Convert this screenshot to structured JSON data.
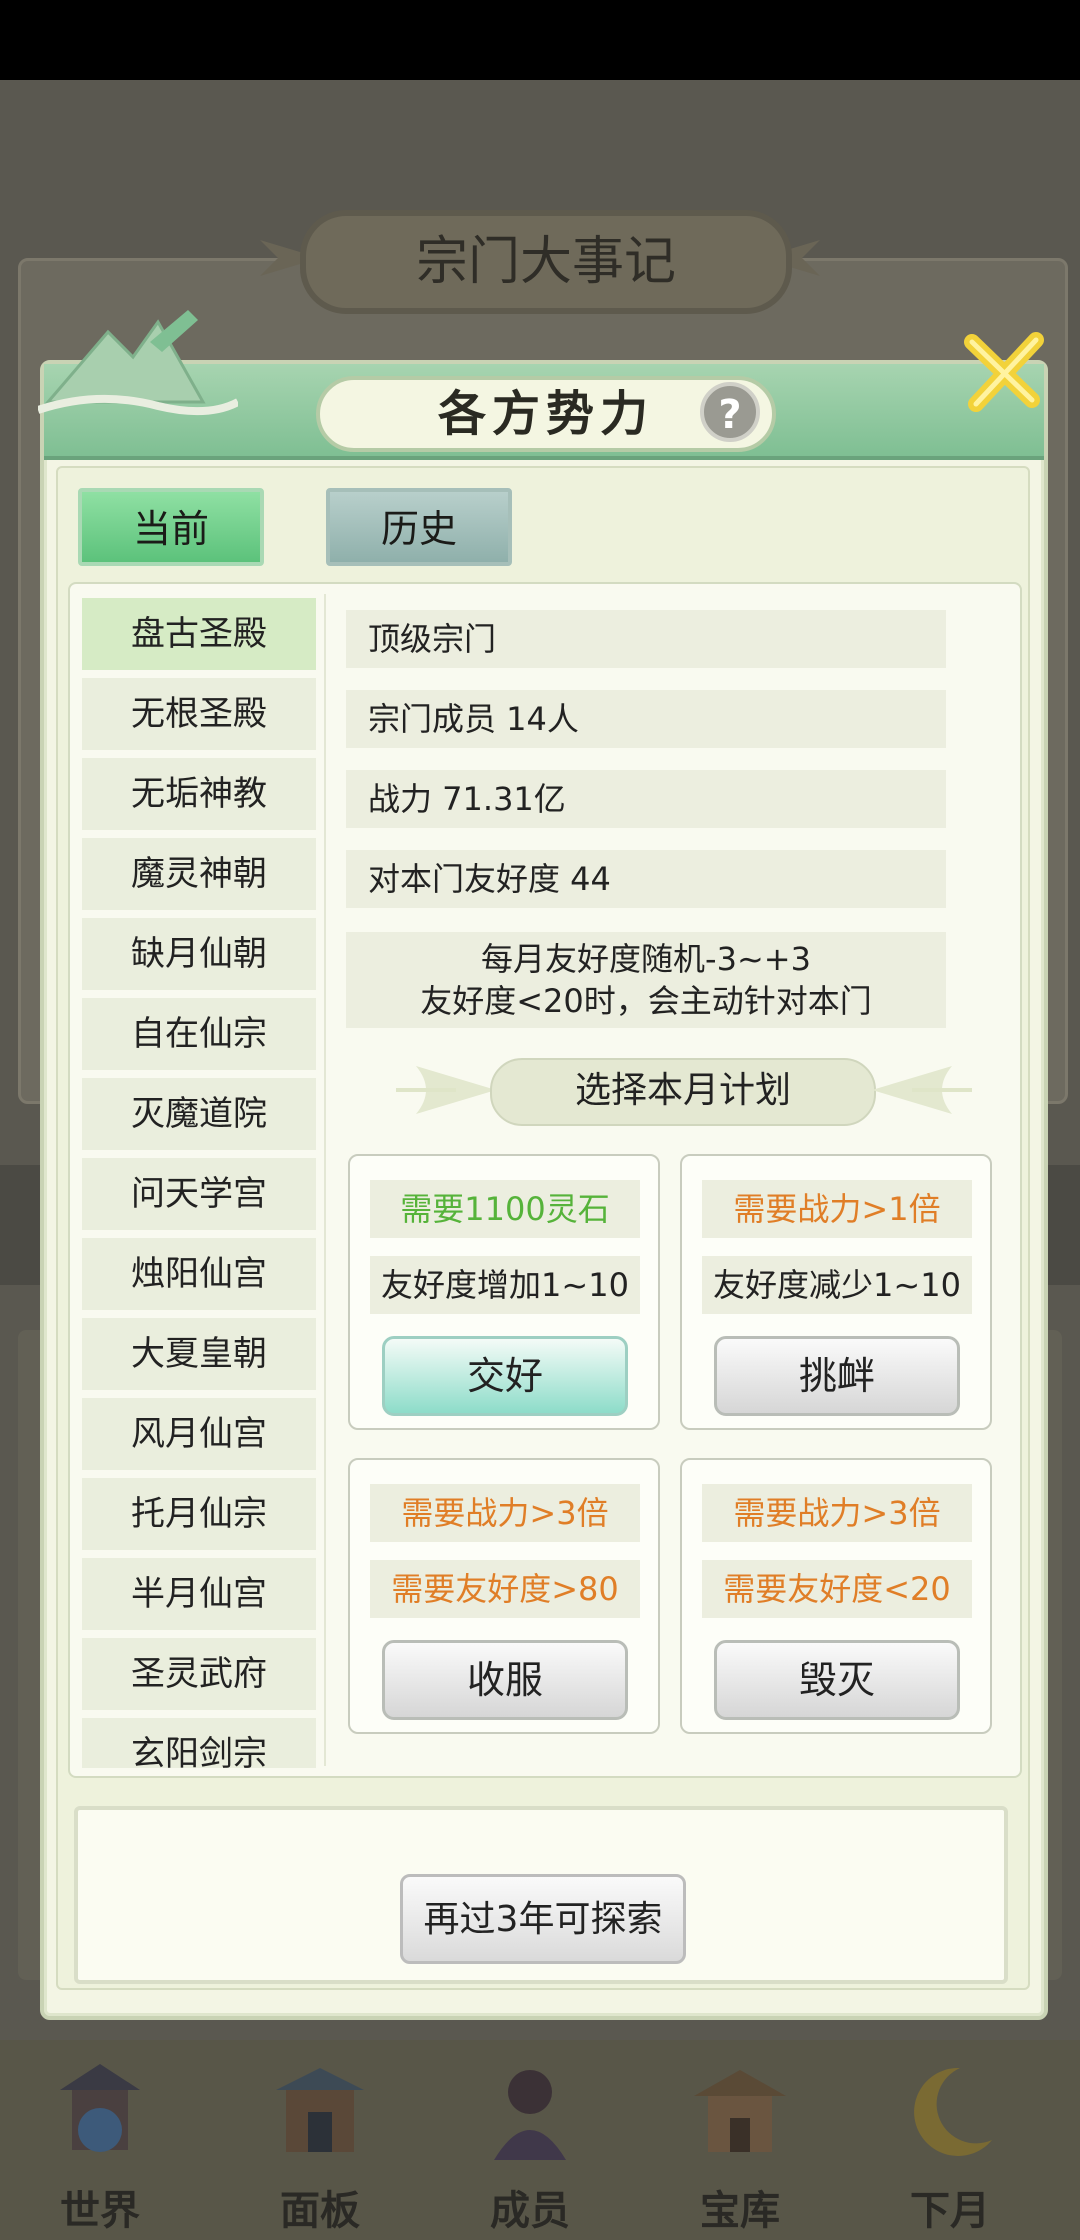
{
  "background": {
    "title": "宗门大事记"
  },
  "modal": {
    "title": "各方势力",
    "help_symbol": "?",
    "tabs": [
      {
        "label": "当前",
        "active": true
      },
      {
        "label": "历史",
        "active": false
      }
    ],
    "factions": [
      {
        "name": "盘古圣殿",
        "selected": true
      },
      {
        "name": "无根圣殿"
      },
      {
        "name": "无垢神教"
      },
      {
        "name": "魔灵神朝"
      },
      {
        "name": "缺月仙朝"
      },
      {
        "name": "自在仙宗"
      },
      {
        "name": "灭魔道院"
      },
      {
        "name": "问天学宫"
      },
      {
        "name": "烛阳仙宫"
      },
      {
        "name": "大夏皇朝"
      },
      {
        "name": "风月仙宫"
      },
      {
        "name": "托月仙宗"
      },
      {
        "name": "半月仙宫"
      },
      {
        "name": "圣灵武府"
      },
      {
        "name": "玄阳剑宗"
      }
    ],
    "info": {
      "rank": "顶级宗门",
      "members": "宗门成员 14人",
      "power": "战力 71.31亿",
      "friendship": "对本门友好度 44",
      "note_line1": "每月友好度随机-3~+3",
      "note_line2": "友好度<20时，会主动针对本门"
    },
    "plan_title": "选择本月计划",
    "actions": [
      {
        "req1": "需要1100灵石",
        "req2": "友好度增加1~10",
        "button": "交好"
      },
      {
        "req1": "需要战力>1倍",
        "req2": "友好度减少1~10",
        "button": "挑衅"
      },
      {
        "req1": "需要战力>3倍",
        "req2": "需要友好度>80",
        "button": "收服"
      },
      {
        "req1": "需要战力>3倍",
        "req2": "需要友好度<20",
        "button": "毁灭"
      }
    ],
    "explore_button": "再过3年可探索"
  },
  "nav": {
    "items": [
      {
        "label": "世界"
      },
      {
        "label": "面板"
      },
      {
        "label": "成员"
      },
      {
        "label": "宝库"
      },
      {
        "label": "下月"
      }
    ]
  },
  "colors": {
    "accent_green": "#5cc27b",
    "requirement_met": "#56b33a",
    "requirement_unmet": "#e07e27"
  }
}
